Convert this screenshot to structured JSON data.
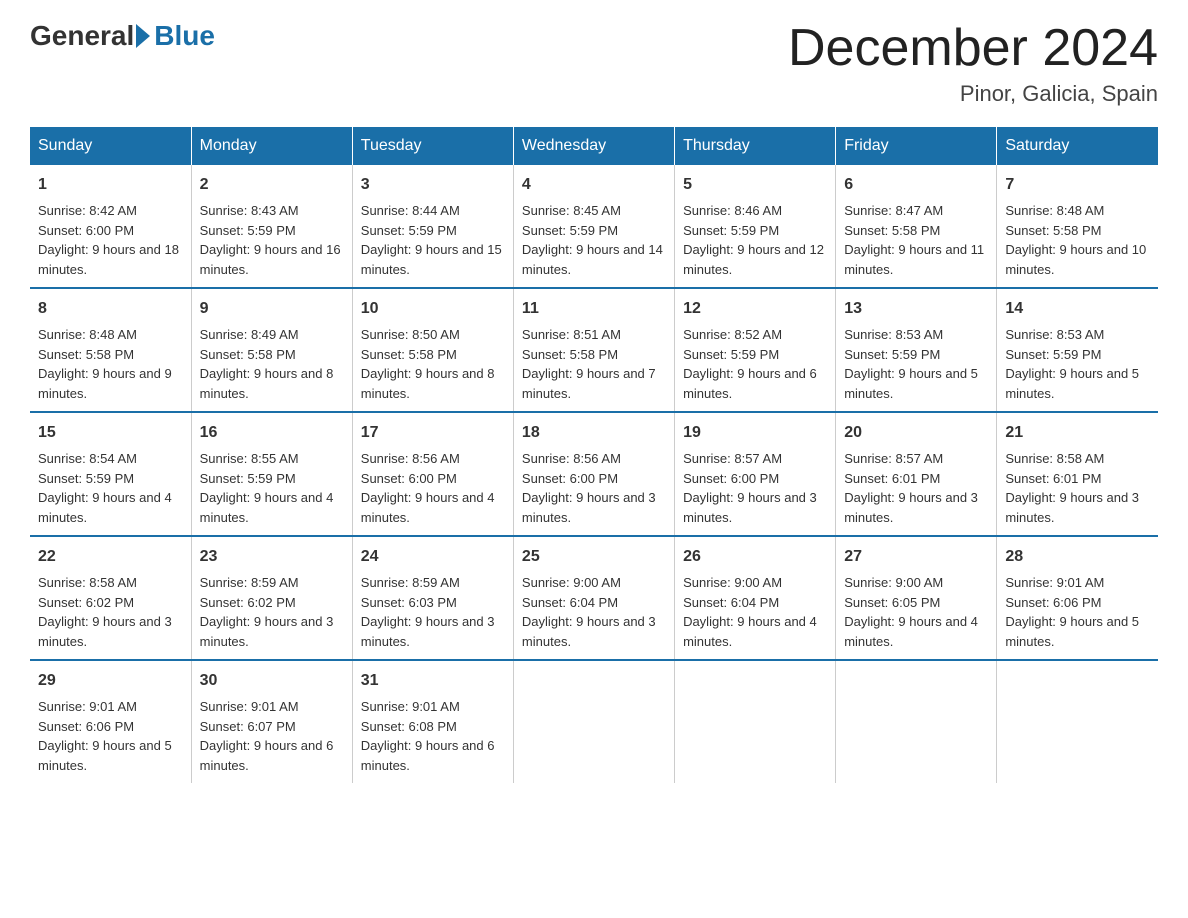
{
  "logo": {
    "general": "General",
    "blue": "Blue"
  },
  "title": "December 2024",
  "location": "Pinor, Galicia, Spain",
  "days_of_week": [
    "Sunday",
    "Monday",
    "Tuesday",
    "Wednesday",
    "Thursday",
    "Friday",
    "Saturday"
  ],
  "weeks": [
    [
      {
        "day": "1",
        "sunrise": "8:42 AM",
        "sunset": "6:00 PM",
        "daylight": "9 hours and 18 minutes."
      },
      {
        "day": "2",
        "sunrise": "8:43 AM",
        "sunset": "5:59 PM",
        "daylight": "9 hours and 16 minutes."
      },
      {
        "day": "3",
        "sunrise": "8:44 AM",
        "sunset": "5:59 PM",
        "daylight": "9 hours and 15 minutes."
      },
      {
        "day": "4",
        "sunrise": "8:45 AM",
        "sunset": "5:59 PM",
        "daylight": "9 hours and 14 minutes."
      },
      {
        "day": "5",
        "sunrise": "8:46 AM",
        "sunset": "5:59 PM",
        "daylight": "9 hours and 12 minutes."
      },
      {
        "day": "6",
        "sunrise": "8:47 AM",
        "sunset": "5:58 PM",
        "daylight": "9 hours and 11 minutes."
      },
      {
        "day": "7",
        "sunrise": "8:48 AM",
        "sunset": "5:58 PM",
        "daylight": "9 hours and 10 minutes."
      }
    ],
    [
      {
        "day": "8",
        "sunrise": "8:48 AM",
        "sunset": "5:58 PM",
        "daylight": "9 hours and 9 minutes."
      },
      {
        "day": "9",
        "sunrise": "8:49 AM",
        "sunset": "5:58 PM",
        "daylight": "9 hours and 8 minutes."
      },
      {
        "day": "10",
        "sunrise": "8:50 AM",
        "sunset": "5:58 PM",
        "daylight": "9 hours and 8 minutes."
      },
      {
        "day": "11",
        "sunrise": "8:51 AM",
        "sunset": "5:58 PM",
        "daylight": "9 hours and 7 minutes."
      },
      {
        "day": "12",
        "sunrise": "8:52 AM",
        "sunset": "5:59 PM",
        "daylight": "9 hours and 6 minutes."
      },
      {
        "day": "13",
        "sunrise": "8:53 AM",
        "sunset": "5:59 PM",
        "daylight": "9 hours and 5 minutes."
      },
      {
        "day": "14",
        "sunrise": "8:53 AM",
        "sunset": "5:59 PM",
        "daylight": "9 hours and 5 minutes."
      }
    ],
    [
      {
        "day": "15",
        "sunrise": "8:54 AM",
        "sunset": "5:59 PM",
        "daylight": "9 hours and 4 minutes."
      },
      {
        "day": "16",
        "sunrise": "8:55 AM",
        "sunset": "5:59 PM",
        "daylight": "9 hours and 4 minutes."
      },
      {
        "day": "17",
        "sunrise": "8:56 AM",
        "sunset": "6:00 PM",
        "daylight": "9 hours and 4 minutes."
      },
      {
        "day": "18",
        "sunrise": "8:56 AM",
        "sunset": "6:00 PM",
        "daylight": "9 hours and 3 minutes."
      },
      {
        "day": "19",
        "sunrise": "8:57 AM",
        "sunset": "6:00 PM",
        "daylight": "9 hours and 3 minutes."
      },
      {
        "day": "20",
        "sunrise": "8:57 AM",
        "sunset": "6:01 PM",
        "daylight": "9 hours and 3 minutes."
      },
      {
        "day": "21",
        "sunrise": "8:58 AM",
        "sunset": "6:01 PM",
        "daylight": "9 hours and 3 minutes."
      }
    ],
    [
      {
        "day": "22",
        "sunrise": "8:58 AM",
        "sunset": "6:02 PM",
        "daylight": "9 hours and 3 minutes."
      },
      {
        "day": "23",
        "sunrise": "8:59 AM",
        "sunset": "6:02 PM",
        "daylight": "9 hours and 3 minutes."
      },
      {
        "day": "24",
        "sunrise": "8:59 AM",
        "sunset": "6:03 PM",
        "daylight": "9 hours and 3 minutes."
      },
      {
        "day": "25",
        "sunrise": "9:00 AM",
        "sunset": "6:04 PM",
        "daylight": "9 hours and 3 minutes."
      },
      {
        "day": "26",
        "sunrise": "9:00 AM",
        "sunset": "6:04 PM",
        "daylight": "9 hours and 4 minutes."
      },
      {
        "day": "27",
        "sunrise": "9:00 AM",
        "sunset": "6:05 PM",
        "daylight": "9 hours and 4 minutes."
      },
      {
        "day": "28",
        "sunrise": "9:01 AM",
        "sunset": "6:06 PM",
        "daylight": "9 hours and 5 minutes."
      }
    ],
    [
      {
        "day": "29",
        "sunrise": "9:01 AM",
        "sunset": "6:06 PM",
        "daylight": "9 hours and 5 minutes."
      },
      {
        "day": "30",
        "sunrise": "9:01 AM",
        "sunset": "6:07 PM",
        "daylight": "9 hours and 6 minutes."
      },
      {
        "day": "31",
        "sunrise": "9:01 AM",
        "sunset": "6:08 PM",
        "daylight": "9 hours and 6 minutes."
      },
      null,
      null,
      null,
      null
    ]
  ]
}
